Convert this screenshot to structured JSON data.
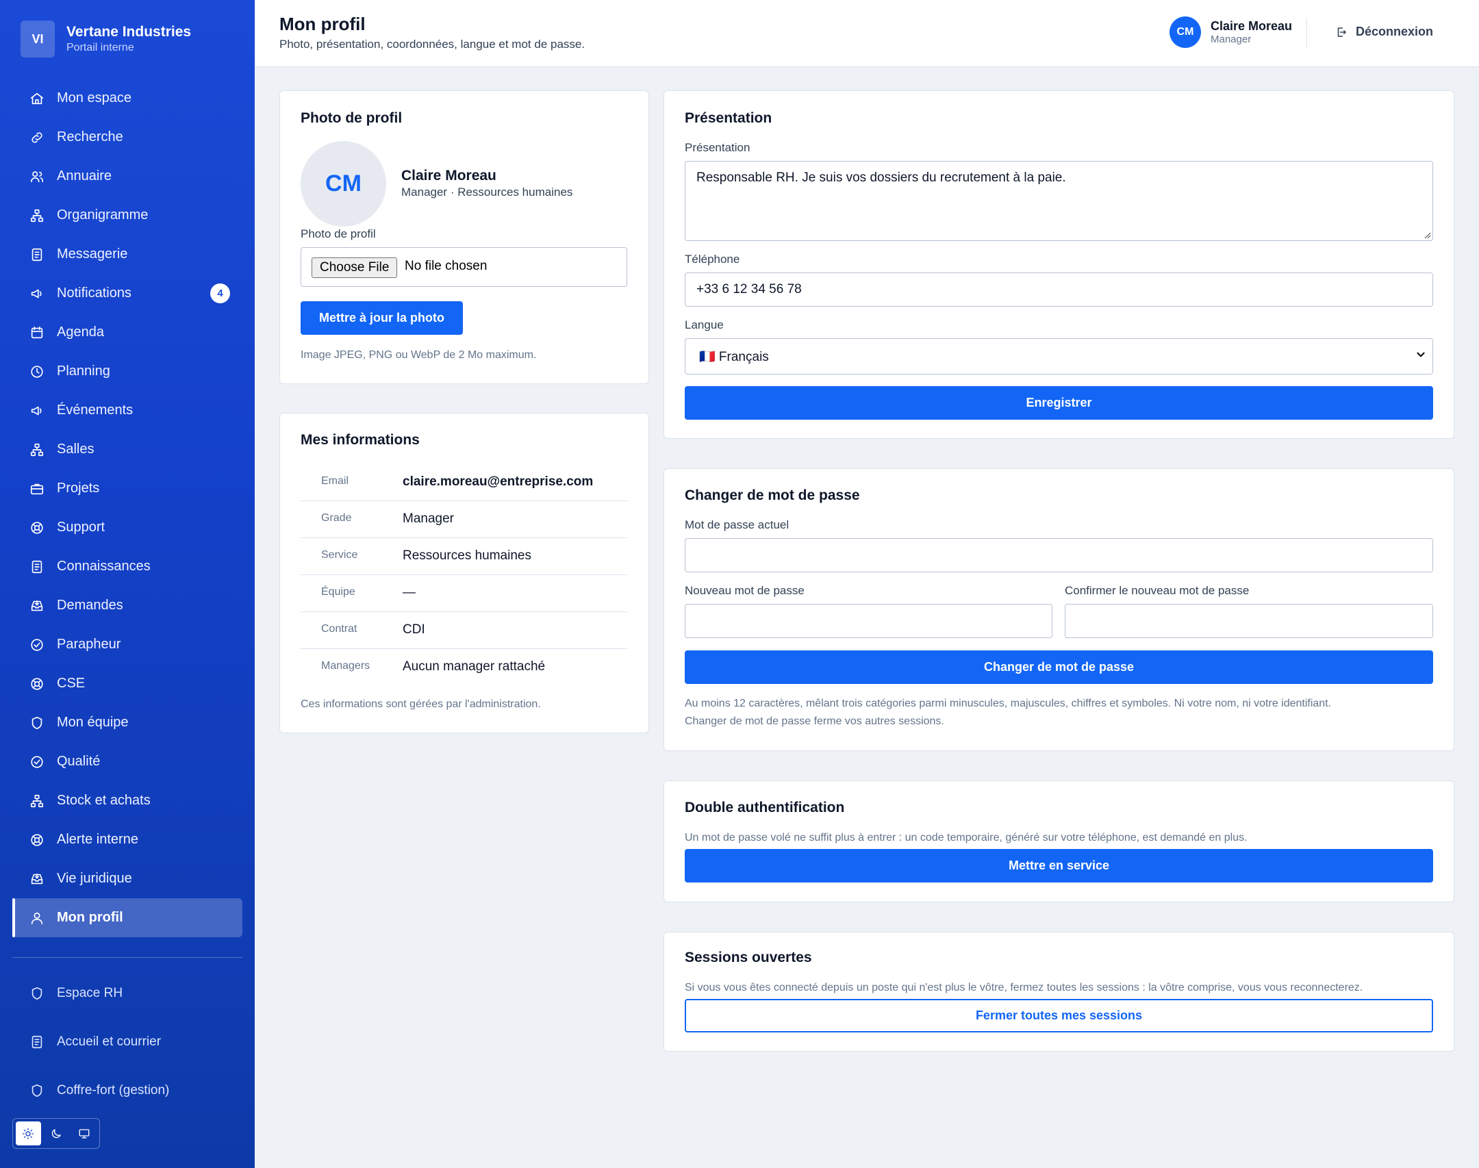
{
  "brand": {
    "initials": "VI",
    "name": "Vertane Industries",
    "subtitle": "Portail interne"
  },
  "sidebar": {
    "items": [
      {
        "label": "Mon espace",
        "icon": "home-icon"
      },
      {
        "label": "Recherche",
        "icon": "link-icon"
      },
      {
        "label": "Annuaire",
        "icon": "users-icon"
      },
      {
        "label": "Organigramme",
        "icon": "org-chart-icon"
      },
      {
        "label": "Messagerie",
        "icon": "document-icon"
      },
      {
        "label": "Notifications",
        "icon": "megaphone-icon",
        "badge": "4"
      },
      {
        "label": "Agenda",
        "icon": "calendar-icon"
      },
      {
        "label": "Planning",
        "icon": "clock-icon"
      },
      {
        "label": "Événements",
        "icon": "megaphone-icon"
      },
      {
        "label": "Salles",
        "icon": "org-chart-icon"
      },
      {
        "label": "Projets",
        "icon": "briefcase-icon"
      },
      {
        "label": "Support",
        "icon": "lifebuoy-icon"
      },
      {
        "label": "Connaissances",
        "icon": "document-icon"
      },
      {
        "label": "Demandes",
        "icon": "inbox-icon"
      },
      {
        "label": "Parapheur",
        "icon": "check-circle-icon"
      },
      {
        "label": "CSE",
        "icon": "lifebuoy-icon"
      },
      {
        "label": "Mon équipe",
        "icon": "shield-icon"
      },
      {
        "label": "Qualité",
        "icon": "check-circle-icon"
      },
      {
        "label": "Stock et achats",
        "icon": "org-chart-icon"
      },
      {
        "label": "Alerte interne",
        "icon": "lifebuoy-icon"
      },
      {
        "label": "Vie juridique",
        "icon": "inbox-icon"
      },
      {
        "label": "Mon profil",
        "icon": "user-icon",
        "active": true
      }
    ],
    "admin_items": [
      {
        "label": "Espace RH",
        "icon": "shield-icon"
      },
      {
        "label": "Accueil et courrier",
        "icon": "document-icon"
      },
      {
        "label": "Coffre-fort (gestion)",
        "icon": "shield-icon"
      }
    ],
    "theme": {
      "options": [
        "sun-icon",
        "moon-icon",
        "monitor-icon"
      ],
      "selected": "sun-icon"
    }
  },
  "header": {
    "title": "Mon profil",
    "subtitle": "Photo, présentation, coordonnées, langue et mot de passe.",
    "user": {
      "initials": "CM",
      "name": "Claire Moreau",
      "role": "Manager"
    },
    "logout_label": "Déconnexion"
  },
  "photo_card": {
    "title": "Photo de profil",
    "avatar_initials": "CM",
    "name": "Claire Moreau",
    "meta": "Manager · Ressources humaines",
    "field_label": "Photo de profil",
    "choose_label": "Choose File",
    "no_file": "No file chosen",
    "button": "Mettre à jour la photo",
    "hint": "Image JPEG, PNG ou WebP de 2 Mo maximum."
  },
  "info_card": {
    "title": "Mes informations",
    "rows": [
      {
        "key": "Email",
        "value": "claire.moreau@entreprise.com"
      },
      {
        "key": "Grade",
        "value": "Manager"
      },
      {
        "key": "Service",
        "value": "Ressources humaines"
      },
      {
        "key": "Équipe",
        "value": "—"
      },
      {
        "key": "Contrat",
        "value": "CDI"
      },
      {
        "key": "Managers",
        "value": "Aucun manager rattaché"
      }
    ],
    "note": "Ces informations sont gérées par l'administration."
  },
  "presentation_card": {
    "title": "Présentation",
    "bio_label": "Présentation",
    "bio_value": "Responsable RH. Je suis vos dossiers du recrutement à la paie.",
    "phone_label": "Téléphone",
    "phone_value": "+33 6 12 34 56 78",
    "lang_label": "Langue",
    "lang_value": "🇫🇷 Français",
    "save_button": "Enregistrer"
  },
  "password_card": {
    "title": "Changer de mot de passe",
    "current_label": "Mot de passe actuel",
    "current_value": "",
    "new_label": "Nouveau mot de passe",
    "new_value": "",
    "confirm_label": "Confirmer le nouveau mot de passe",
    "confirm_value": "",
    "button": "Changer de mot de passe",
    "hint_line1": "Au moins 12 caractères, mêlant trois catégories parmi minuscules, majuscules, chiffres et symboles. Ni votre nom, ni votre identifiant.",
    "hint_line2": "Changer de mot de passe ferme vos autres sessions."
  },
  "mfa_card": {
    "title": "Double authentification",
    "hint": "Un mot de passe volé ne suffit plus à entrer : un code temporaire, généré sur votre téléphone, est demandé en plus.",
    "button": "Mettre en service"
  },
  "sessions_card": {
    "title": "Sessions ouvertes",
    "hint": "Si vous vous êtes connecté depuis un poste qui n'est plus le vôtre, fermez toutes les sessions : la vôtre comprise, vous vous reconnecterez.",
    "button": "Fermer toutes mes sessions"
  },
  "colors": {
    "primary": "#1366f5",
    "sidebar": "#1440c8",
    "background": "#eef1f6"
  }
}
